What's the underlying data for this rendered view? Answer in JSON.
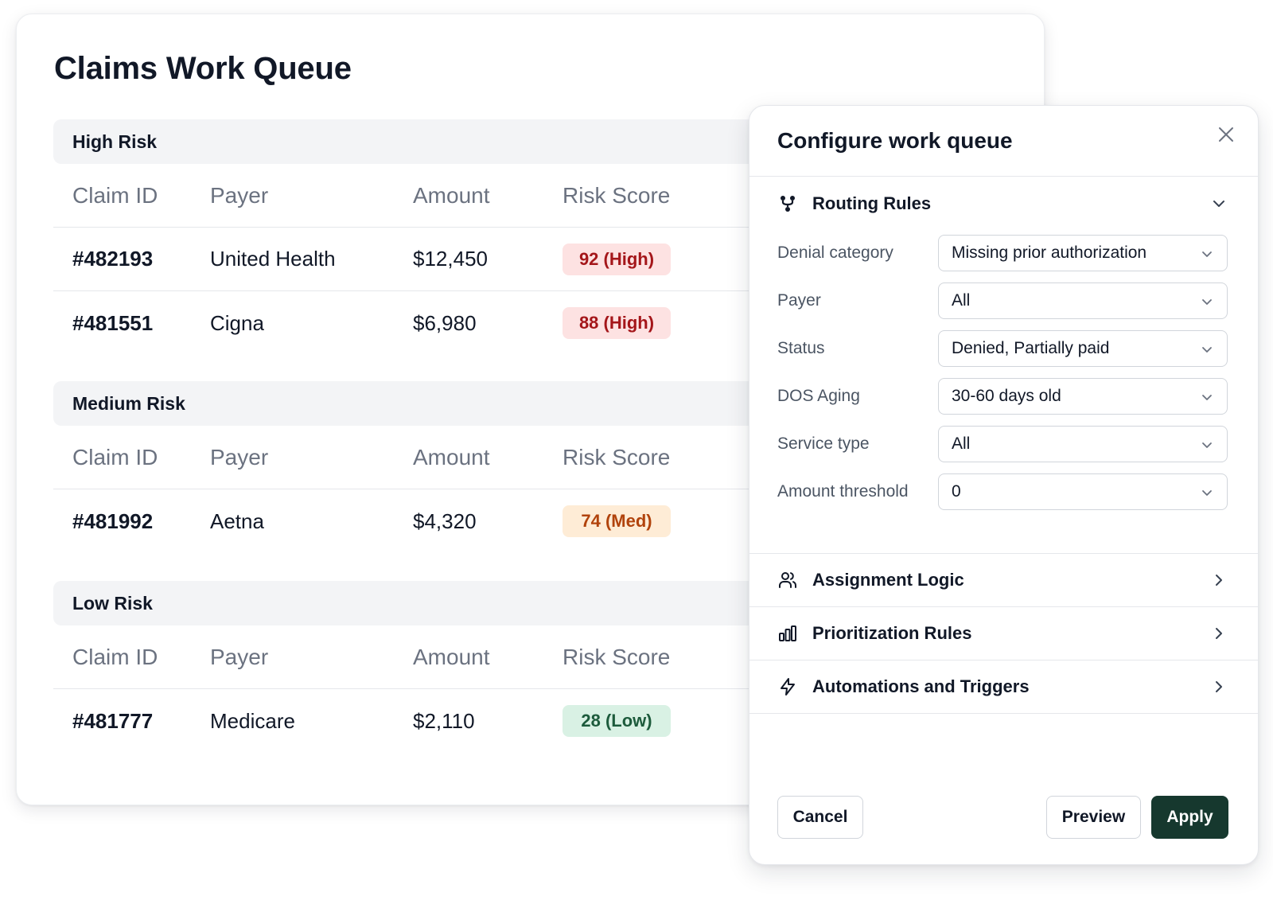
{
  "claims_queue": {
    "title": "Claims Work Queue",
    "columns": [
      "Claim ID",
      "Payer",
      "Amount",
      "Risk Score"
    ],
    "groups": [
      {
        "name": "High Risk",
        "rows": [
          {
            "id": "#482193",
            "payer": "United Health",
            "amount": "$12,450",
            "risk": "92 (High)",
            "level": "high"
          },
          {
            "id": "#481551",
            "payer": "Cigna",
            "amount": "$6,980",
            "risk": "88 (High)",
            "level": "high"
          }
        ]
      },
      {
        "name": "Medium Risk",
        "rows": [
          {
            "id": "#481992",
            "payer": "Aetna",
            "amount": "$4,320",
            "risk": "74 (Med)",
            "level": "med"
          }
        ]
      },
      {
        "name": "Low Risk",
        "rows": [
          {
            "id": "#481777",
            "payer": "Medicare",
            "amount": "$2,110",
            "risk": "28 (Low)",
            "level": "low"
          }
        ]
      }
    ]
  },
  "config_panel": {
    "title": "Configure work queue",
    "close_icon": "close-icon",
    "routing": {
      "label": "Routing Rules",
      "icon": "routing-icon",
      "expanded": true,
      "fields": [
        {
          "label": "Denial category",
          "value": "Missing prior authorization"
        },
        {
          "label": "Payer",
          "value": "All"
        },
        {
          "label": "Status",
          "value": "Denied, Partially paid"
        },
        {
          "label": "DOS Aging",
          "value": "30-60 days old"
        },
        {
          "label": "Service type",
          "value": "All"
        },
        {
          "label": "Amount threshold",
          "value": "0"
        }
      ]
    },
    "sections": [
      {
        "label": "Assignment Logic",
        "icon": "users-icon"
      },
      {
        "label": "Prioritization Rules",
        "icon": "bar-chart-icon"
      },
      {
        "label": "Automations and Triggers",
        "icon": "lightning-icon"
      }
    ],
    "buttons": {
      "cancel": "Cancel",
      "preview": "Preview",
      "apply": "Apply"
    }
  },
  "colors": {
    "primary": "#16382e",
    "high_badge_bg": "#fde2e2",
    "high_badge_text": "#a4161a",
    "med_badge_bg": "#feecd6",
    "med_badge_text": "#b1430c",
    "low_badge_bg": "#d9f1e4",
    "low_badge_text": "#1d5b3c"
  }
}
